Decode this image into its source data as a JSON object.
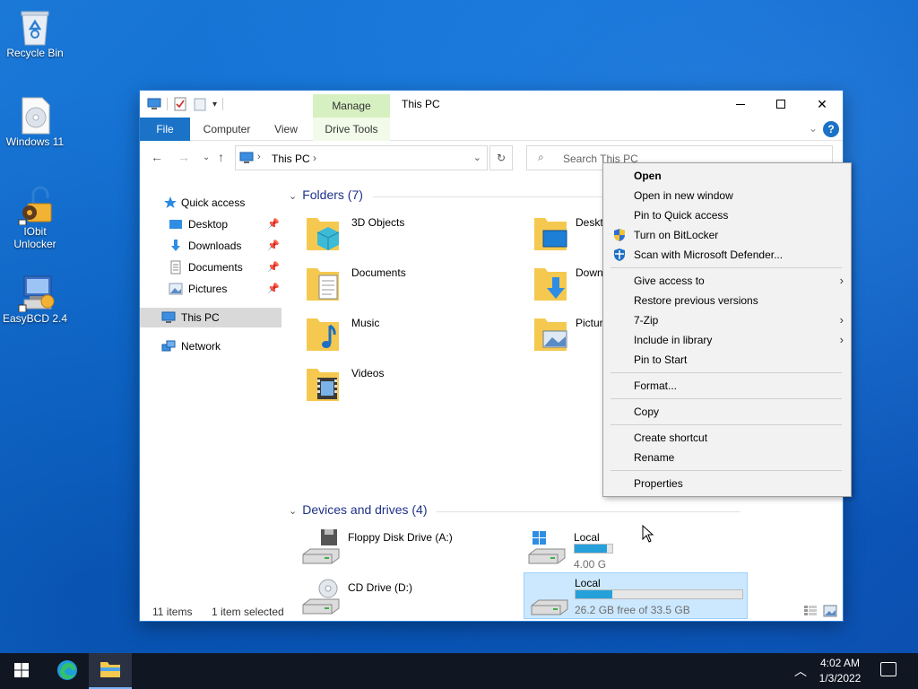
{
  "desktop": {
    "icons": [
      {
        "label": "Recycle Bin",
        "icon": "recycle-bin-icon"
      },
      {
        "label": "Windows 11",
        "icon": "disc-image-icon"
      },
      {
        "label": "IObit Unlocker",
        "icon": "iobit-unlocker-icon"
      },
      {
        "label": "EasyBCD 2.4",
        "icon": "easybcd-icon"
      }
    ]
  },
  "window": {
    "title": "This PC",
    "manage_tab": "Manage",
    "ribbon_tabs": {
      "file": "File",
      "computer": "Computer",
      "view": "View",
      "drive_tools": "Drive Tools"
    },
    "help": "?",
    "address": {
      "crumb": "This PC"
    },
    "search": {
      "placeholder": "Search This PC"
    }
  },
  "sidebar": {
    "quick_access": "Quick access",
    "items": [
      {
        "label": "Desktop",
        "icon": "desktop-folder-icon",
        "pinned": true
      },
      {
        "label": "Downloads",
        "icon": "downloads-folder-icon",
        "pinned": true
      },
      {
        "label": "Documents",
        "icon": "documents-folder-icon",
        "pinned": true
      },
      {
        "label": "Pictures",
        "icon": "pictures-folder-icon",
        "pinned": true
      }
    ],
    "this_pc": "This PC",
    "network": "Network"
  },
  "content": {
    "folders_header": "Folders (7)",
    "folders": [
      {
        "label": "3D Objects",
        "icon": "3d-objects-folder-icon"
      },
      {
        "label": "Deskto",
        "icon": "desktop-folder-icon"
      },
      {
        "label": "Documents",
        "icon": "documents-folder-icon"
      },
      {
        "label": "Down",
        "icon": "downloads-folder-icon"
      },
      {
        "label": "Music",
        "icon": "music-folder-icon"
      },
      {
        "label": "Pictur",
        "icon": "pictures-folder-icon"
      },
      {
        "label": "Videos",
        "icon": "videos-folder-icon"
      }
    ],
    "drives_header": "Devices and drives (4)",
    "drives": [
      {
        "label": "Floppy Disk Drive (A:)",
        "icon": "floppy-drive-icon"
      },
      {
        "label": "Local",
        "icon": "windows-drive-icon",
        "free_text": "4.00 G",
        "used_fraction": 0.85
      },
      {
        "label": "CD Drive (D:)",
        "icon": "cd-drive-icon"
      },
      {
        "label": "Local",
        "icon": "hard-drive-icon",
        "free_text": "26.2 GB free of 33.5 GB",
        "used_fraction": 0.22,
        "selected": true
      }
    ]
  },
  "status": {
    "items": "11 items",
    "selected": "1 item selected"
  },
  "context_menu": {
    "items": [
      {
        "label": "Open",
        "default": true
      },
      {
        "label": "Open in new window"
      },
      {
        "label": "Pin to Quick access"
      },
      {
        "label": "Turn on BitLocker",
        "icon": "shield-icon"
      },
      {
        "label": "Scan with Microsoft Defender...",
        "icon": "defender-icon"
      },
      {
        "label": "Give access to",
        "submenu": true
      },
      {
        "label": "Restore previous versions"
      },
      {
        "label": "7-Zip",
        "submenu": true
      },
      {
        "label": "Include in library",
        "submenu": true
      },
      {
        "label": "Pin to Start"
      },
      {
        "label": "Format..."
      },
      {
        "label": "Copy"
      },
      {
        "label": "Create shortcut"
      },
      {
        "label": "Rename"
      },
      {
        "label": "Properties"
      }
    ]
  },
  "taskbar": {
    "time": "4:02 AM",
    "date": "1/3/2022"
  },
  "colors": {
    "accent": "#1a73c7",
    "manage_tab": "#d7f0c2",
    "drive_fill": "#26a0da",
    "selection": "#cce8ff",
    "taskbar": "#101622"
  }
}
